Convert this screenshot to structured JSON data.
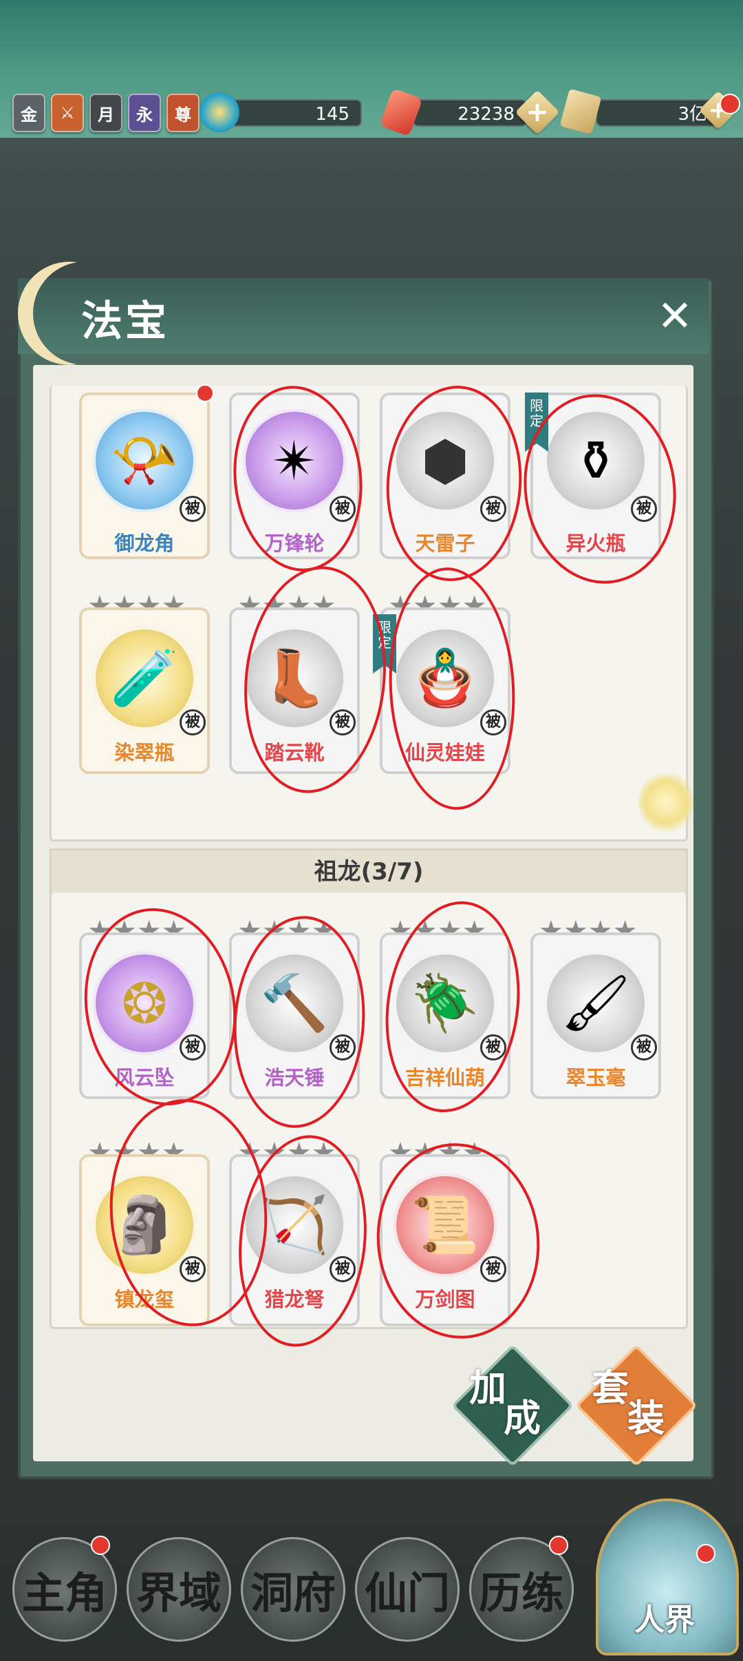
{
  "topbar": {
    "badges": [
      {
        "label": "金",
        "color": "#5b6268",
        "icon": "gold-badge-icon"
      },
      {
        "label": "",
        "color": "#c8612e",
        "icon": "crossed-swords-badge-icon"
      },
      {
        "label": "月",
        "color": "#43464a",
        "icon": "moon-badge-icon"
      },
      {
        "label": "永",
        "color": "#5c4f92",
        "icon": "eternal-badge-icon"
      },
      {
        "label": "尊",
        "color": "#c0532e",
        "icon": "supreme-badge-icon"
      }
    ],
    "spirit_value": "145",
    "crystal_value": "23238",
    "scroll_value": "3亿",
    "plus_label": "+"
  },
  "panel": {
    "title": "法宝",
    "close_label": "✕"
  },
  "section1": {
    "items": [
      {
        "name": "御龙角",
        "tag": "被",
        "color": "blue",
        "glyph": "📯"
      },
      {
        "name": "万锋轮",
        "tag": "被",
        "color": "purple",
        "glyph": "✴"
      },
      {
        "name": "天雷子",
        "tag": "被",
        "color": "grey",
        "glyph": "⬢"
      },
      {
        "name": "异火瓶",
        "tag": "被",
        "color": "grey",
        "glyph": "⚱",
        "limited": "限定"
      },
      {
        "name": "染翠瓶",
        "tag": "被",
        "color": "gold",
        "glyph": "🧪"
      },
      {
        "name": "踏云靴",
        "tag": "被",
        "color": "grey",
        "glyph": "👢"
      },
      {
        "name": "仙灵娃娃",
        "tag": "被",
        "color": "grey",
        "glyph": "🪆",
        "limited": "限定"
      }
    ]
  },
  "section2": {
    "title": "祖龙(3/7)",
    "items": [
      {
        "name": "风云坠",
        "tag": "被",
        "color": "purple",
        "glyph": "❂"
      },
      {
        "name": "浩天锤",
        "tag": "被",
        "color": "grey",
        "glyph": "🔨"
      },
      {
        "name": "吉祥仙葫",
        "tag": "被",
        "color": "grey",
        "glyph": "🪲"
      },
      {
        "name": "翠玉毫",
        "tag": "被",
        "color": "grey",
        "glyph": "🖌"
      },
      {
        "name": "镇龙玺",
        "tag": "被",
        "color": "gold",
        "glyph": "🗿"
      },
      {
        "name": "猎龙弩",
        "tag": "被",
        "color": "grey",
        "glyph": "🏹"
      },
      {
        "name": "万剑图",
        "tag": "被",
        "color": "red",
        "glyph": "📜"
      }
    ]
  },
  "actions": {
    "bonus_label_1": "加",
    "bonus_label_2": "成",
    "set_label_1": "套",
    "set_label_2": "装",
    "bonus_color": "#2f5f4f",
    "set_color": "#e27d3a"
  },
  "nav": {
    "items": [
      "主角",
      "界域",
      "洞府",
      "仙门",
      "历练"
    ],
    "realm_label": "人界"
  }
}
